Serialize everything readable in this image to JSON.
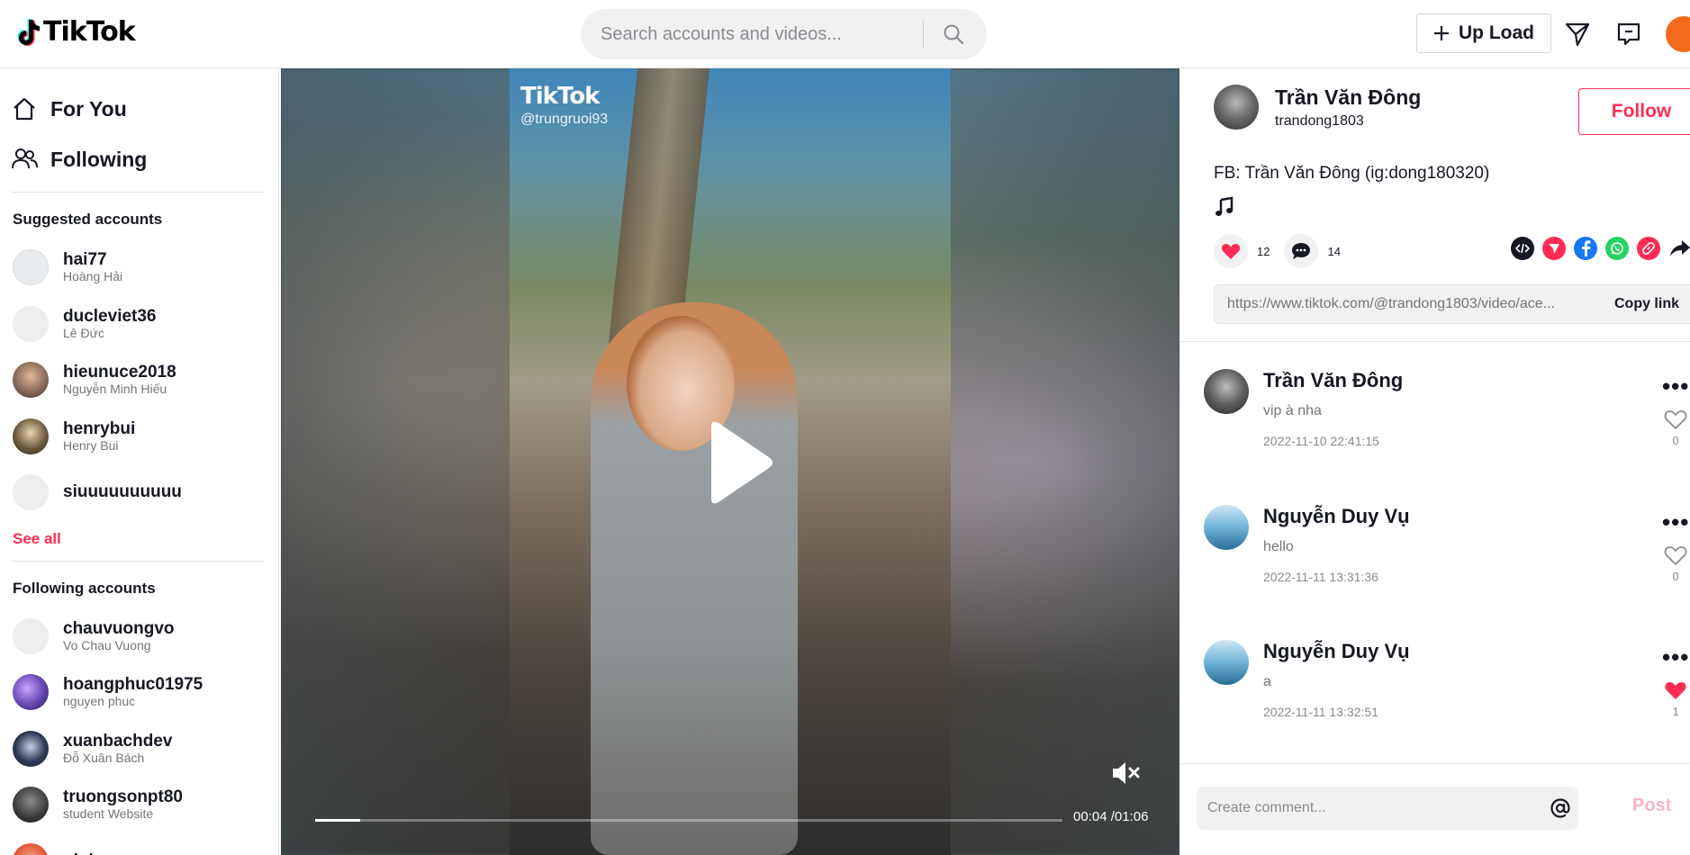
{
  "header": {
    "logo_text": "TikTok",
    "search_placeholder": "Search accounts and videos...",
    "upload_label": "Up Load"
  },
  "sidebar": {
    "nav": [
      {
        "label": "For You",
        "icon": "home-icon"
      },
      {
        "label": "Following",
        "icon": "people-icon"
      }
    ],
    "suggested_title": "Suggested accounts",
    "suggested": [
      {
        "username": "hai77",
        "name": "Hoàng Hải",
        "avatar_color": "#e9ecef"
      },
      {
        "username": "ducleviet36",
        "name": "Lê Đức",
        "avatar_color": "#eeeeee"
      },
      {
        "username": "hieunuce2018",
        "name": "Nguyễn Minh Hiếu",
        "avatar_color": "#8a6b5a"
      },
      {
        "username": "henrybui",
        "name": "Henry Bui",
        "avatar_color": "#6f5a3f"
      },
      {
        "username": "siuuuuuuuuuu",
        "name": "",
        "avatar_color": "#eeeeee"
      }
    ],
    "see_all": "See all",
    "following_title": "Following accounts",
    "following": [
      {
        "username": "chauvuongvo",
        "name": "Vo Chau Vuong",
        "avatar_color": "#eeeeee"
      },
      {
        "username": "hoangphuc01975",
        "name": "nguyen phuc",
        "avatar_color": "#6c4db8"
      },
      {
        "username": "xuanbachdev",
        "name": "Đỗ Xuân Bách",
        "avatar_color": "#2e3a55"
      },
      {
        "username": "truongsonpt80",
        "name": "student Website",
        "avatar_color": "#3a3a3a"
      },
      {
        "username": "ninhnam",
        "name": "",
        "avatar_color": "#e24a2b"
      }
    ]
  },
  "video": {
    "watermark_logo": "TikTok",
    "watermark_user": "@trungruoi93",
    "time": "00:04 /01:06",
    "progress": 0.06
  },
  "post": {
    "author_name": "Trần Văn Đông",
    "author_username": "trandong1803",
    "follow_label": "Follow",
    "description": "FB: Trần Văn Đông (ig:dong180320)",
    "likes": "12",
    "comments_count": "14",
    "url": "https://www.tiktok.com/@trandong1803/video/ace...",
    "copy_label": "Copy link"
  },
  "comments": [
    {
      "name": "Trần Văn Đông",
      "text": "vip à nha",
      "date": "2022-11-10 22:41:15",
      "likes": "0",
      "liked": false,
      "avatar_color": "#4a4a4a"
    },
    {
      "name": "Nguyễn Duy Vụ",
      "text": "hello",
      "date": "2022-11-11 13:31:36",
      "likes": "0",
      "liked": false,
      "avatar_color": "#5aa8d6"
    },
    {
      "name": "Nguyễn Duy Vụ",
      "text": "a",
      "date": "2022-11-11 13:32:51",
      "likes": "1",
      "liked": true,
      "avatar_color": "#5aa8d6"
    }
  ],
  "comment_input": {
    "placeholder": "Create comment...",
    "post_label": "Post"
  },
  "colors": {
    "brand": "#fe2c55",
    "avatar_top": "#f26a1b"
  }
}
